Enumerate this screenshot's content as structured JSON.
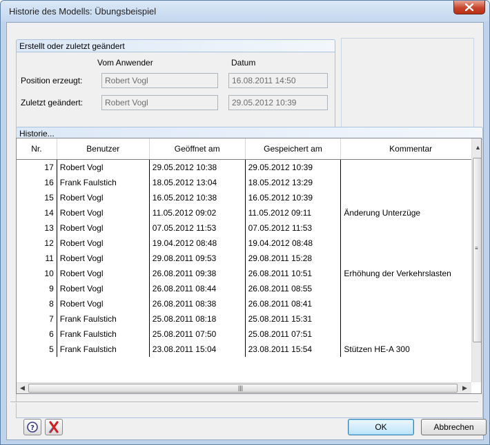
{
  "window": {
    "title": "Historie des Modells: Übungsbeispiel"
  },
  "created_group": {
    "title": "Erstellt oder zuletzt geändert",
    "col_user": "Vom Anwender",
    "col_date": "Datum",
    "rows": [
      {
        "label": "Position erzeugt:",
        "user": "Robert Vogl",
        "date": "16.08.2011 14:50"
      },
      {
        "label": "Zuletzt geändert:",
        "user": "Robert Vogl",
        "date": "29.05.2012 10:39"
      }
    ]
  },
  "history_group": {
    "title": "Historie...",
    "columns": [
      "Nr.",
      "Benutzer",
      "Geöffnet am",
      "Gespeichert am",
      "Kommentar"
    ],
    "rows": [
      [
        "17",
        "Robert Vogl",
        "29.05.2012 10:38",
        "29.05.2012 10:39",
        ""
      ],
      [
        "16",
        "Frank Faulstich",
        "18.05.2012 13:04",
        "18.05.2012 13:29",
        ""
      ],
      [
        "15",
        "Robert Vogl",
        "16.05.2012 10:38",
        "16.05.2012 10:39",
        ""
      ],
      [
        "14",
        "Robert Vogl",
        "11.05.2012 09:02",
        "11.05.2012 09:11",
        "Änderung Unterzüge"
      ],
      [
        "13",
        "Robert Vogl",
        "07.05.2012 11:53",
        "07.05.2012 11:53",
        ""
      ],
      [
        "12",
        "Robert Vogl",
        "19.04.2012 08:48",
        "19.04.2012 08:48",
        ""
      ],
      [
        "11",
        "Robert Vogl",
        "29.08.2011 09:53",
        "29.08.2011 15:28",
        ""
      ],
      [
        "10",
        "Robert Vogl",
        "26.08.2011 09:38",
        "26.08.2011 10:51",
        "Erhöhung der Verkehrslasten"
      ],
      [
        "9",
        "Robert Vogl",
        "26.08.2011 08:44",
        "26.08.2011 08:55",
        ""
      ],
      [
        "8",
        "Robert Vogl",
        "26.08.2011 08:38",
        "26.08.2011 08:41",
        ""
      ],
      [
        "7",
        "Frank Faulstich",
        "25.08.2011 08:18",
        "25.08.2011 15:31",
        ""
      ],
      [
        "6",
        "Frank Faulstich",
        "25.08.2011 07:50",
        "25.08.2011 07:51",
        ""
      ],
      [
        "5",
        "Frank Faulstich",
        "23.08.2011 15:04",
        "23.08.2011 15:54",
        "Stützen HE-A 300"
      ]
    ]
  },
  "buttons": {
    "ok": "OK",
    "cancel": "Abbrechen"
  },
  "icons": {
    "help": "help-icon",
    "delete": "delete-icon",
    "close": "close-icon"
  },
  "colors": {
    "accent": "#3c7fb1",
    "delete_red": "#d21f1f",
    "group_border": "#a9c2e0"
  }
}
